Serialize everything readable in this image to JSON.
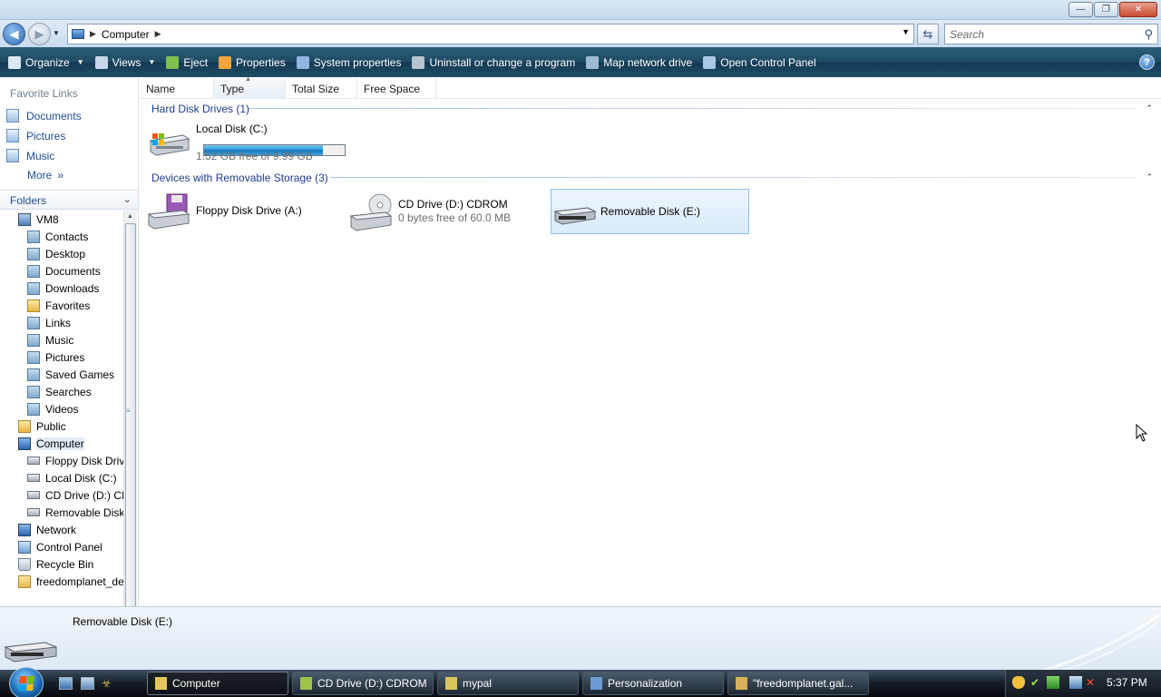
{
  "window": {
    "minimize_glyph": "—",
    "maximize_glyph": "❐",
    "close_glyph": "✕"
  },
  "address": {
    "crumb": "Computer",
    "search_placeholder": "Search"
  },
  "commandbar": {
    "items": [
      {
        "label": "Organize",
        "icon": "organize-icon",
        "color": "#dbe7f3",
        "has_dropdown": true
      },
      {
        "label": "Views",
        "icon": "views-icon",
        "color": "#c6d6e8",
        "has_dropdown": true
      },
      {
        "label": "Eject",
        "icon": "eject-icon",
        "color": "#7fc04f",
        "has_dropdown": false
      },
      {
        "label": "Properties",
        "icon": "properties-icon",
        "color": "#f1a53a",
        "has_dropdown": false
      },
      {
        "label": "System properties",
        "icon": "system-properties-icon",
        "color": "#8fb7e2",
        "has_dropdown": false
      },
      {
        "label": "Uninstall or change a program",
        "icon": "uninstall-icon",
        "color": "#b9c3cc",
        "has_dropdown": false
      },
      {
        "label": "Map network drive",
        "icon": "map-network-drive-icon",
        "color": "#9fb9d2",
        "has_dropdown": false
      },
      {
        "label": "Open Control Panel",
        "icon": "control-panel-icon",
        "color": "#a9c7e6",
        "has_dropdown": false
      }
    ],
    "help_glyph": "?"
  },
  "navpane": {
    "favorite_links_heading": "Favorite Links",
    "favorites": [
      "Documents",
      "Pictures",
      "Music"
    ],
    "more_label": "More",
    "more_glyph": "»",
    "folders_label": "Folders",
    "tree": [
      {
        "label": "VM8",
        "indent": 1,
        "icon": "user"
      },
      {
        "label": "Contacts",
        "indent": 2,
        "icon": "folder"
      },
      {
        "label": "Desktop",
        "indent": 2,
        "icon": "folder"
      },
      {
        "label": "Documents",
        "indent": 2,
        "icon": "folder"
      },
      {
        "label": "Downloads",
        "indent": 2,
        "icon": "folder"
      },
      {
        "label": "Favorites",
        "indent": 2,
        "icon": "yfolder"
      },
      {
        "label": "Links",
        "indent": 2,
        "icon": "folder"
      },
      {
        "label": "Music",
        "indent": 2,
        "icon": "folder"
      },
      {
        "label": "Pictures",
        "indent": 2,
        "icon": "folder"
      },
      {
        "label": "Saved Games",
        "indent": 2,
        "icon": "folder"
      },
      {
        "label": "Searches",
        "indent": 2,
        "icon": "folder"
      },
      {
        "label": "Videos",
        "indent": 2,
        "icon": "folder"
      },
      {
        "label": "Public",
        "indent": 1,
        "icon": "yfolder"
      },
      {
        "label": "Computer",
        "indent": 1,
        "icon": "comp",
        "selected": true
      },
      {
        "label": "Floppy Disk Driv",
        "indent": 2,
        "icon": "drive"
      },
      {
        "label": "Local Disk (C:)",
        "indent": 2,
        "icon": "drive"
      },
      {
        "label": "CD Drive (D:) CI",
        "indent": 2,
        "icon": "drive"
      },
      {
        "label": "Removable Disk",
        "indent": 2,
        "icon": "drive"
      },
      {
        "label": "Network",
        "indent": 1,
        "icon": "comp"
      },
      {
        "label": "Control Panel",
        "indent": 1,
        "icon": "cpanel"
      },
      {
        "label": "Recycle Bin",
        "indent": 1,
        "icon": "bin"
      },
      {
        "label": "freedomplanet_de",
        "indent": 1,
        "icon": "yfolder"
      }
    ]
  },
  "columns": [
    "Name",
    "Type",
    "Total Size",
    "Free Space"
  ],
  "groups": {
    "hard_disks": {
      "title": "Hard Disk Drives (1)",
      "items": [
        {
          "name": "Local Disk (C:)",
          "free_text": "1.52 GB free of 9.99 GB",
          "used_fraction": 0.848
        }
      ]
    },
    "removable": {
      "title": "Devices with Removable Storage (3)",
      "items": [
        {
          "name": "Floppy Disk Drive (A:)",
          "sub": ""
        },
        {
          "name": "CD Drive (D:) CDROM",
          "sub": "0 bytes free of 60.0 MB"
        },
        {
          "name": "Removable Disk (E:)",
          "sub": "",
          "selected": true
        }
      ]
    }
  },
  "details": {
    "title": "Removable Disk (E:)"
  },
  "taskbar": {
    "buttons": [
      {
        "label": "Computer",
        "active": true
      },
      {
        "label": "CD Drive (D:) CDROM",
        "active": false
      },
      {
        "label": "mypal",
        "active": false
      },
      {
        "label": "Personalization",
        "active": false
      },
      {
        "label": "\"freedomplanet.gal...",
        "active": false
      }
    ],
    "clock": "5:37 PM"
  }
}
